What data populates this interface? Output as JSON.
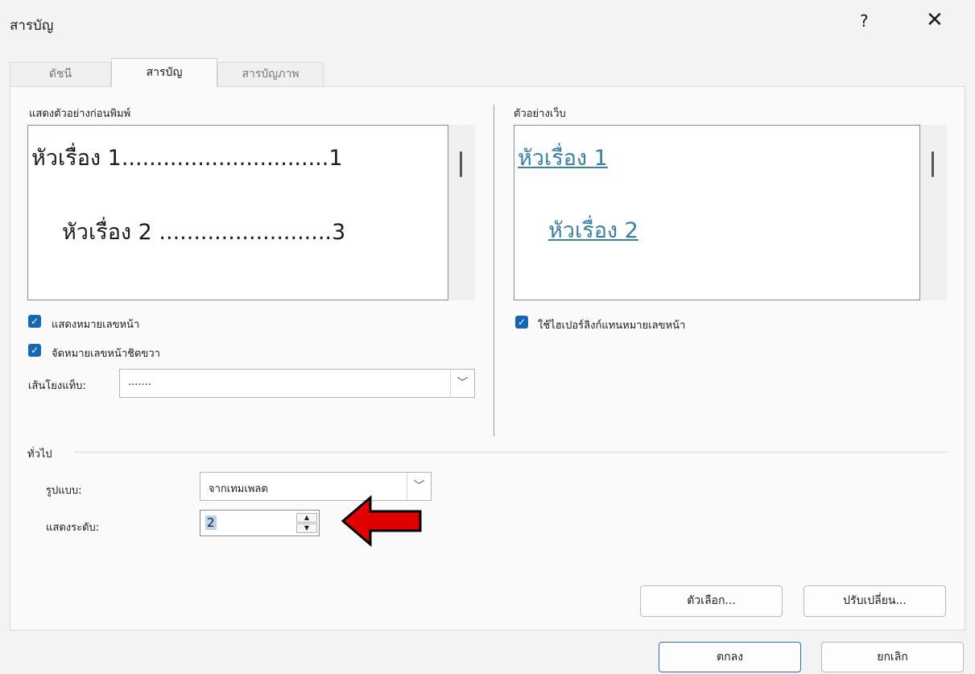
{
  "window": {
    "title": "สารบัญ",
    "help_label": "?",
    "close_label": "✕"
  },
  "tabs": [
    {
      "label": "ดัชนี"
    },
    {
      "label": "สารบัญ"
    },
    {
      "label": "สารบัญภาพ"
    }
  ],
  "print_preview": {
    "label": "แสดงตัวอย่างก่อนพิมพ์",
    "heading1": "หัวเรื่อง 1..............................1",
    "heading2": "หัวเรื่อง 2 .........................3"
  },
  "web_preview": {
    "label": "ตัวอย่างเว็บ",
    "heading1": "หัวเรื่อง 1",
    "heading2": "หัวเรื่อง 2"
  },
  "options": {
    "show_page_numbers": "แสดงหมายเลขหน้า",
    "right_align": "จัดหมายเลขหน้าชิดขวา",
    "tab_leader_label": "เส้นโยงแท็บ:",
    "tab_leader_value": ".......",
    "use_hyperlinks": "ใช้ไฮเปอร์ลิงก์แทนหมายเลขหน้า"
  },
  "general": {
    "section_label": "ทั่วไป",
    "format_label": "รูปแบบ:",
    "format_value": "จากเทมเพลต",
    "levels_label": "แสดงระดับ:",
    "levels_value": "2"
  },
  "buttons": {
    "options": "ตัวเลือก...",
    "modify": "ปรับเปลี่ยน...",
    "ok": "ตกลง",
    "cancel": "ยกเลิก"
  },
  "colors": {
    "accent": "#1667b3",
    "arrow": "#e00000",
    "link": "#3b7ea1"
  }
}
